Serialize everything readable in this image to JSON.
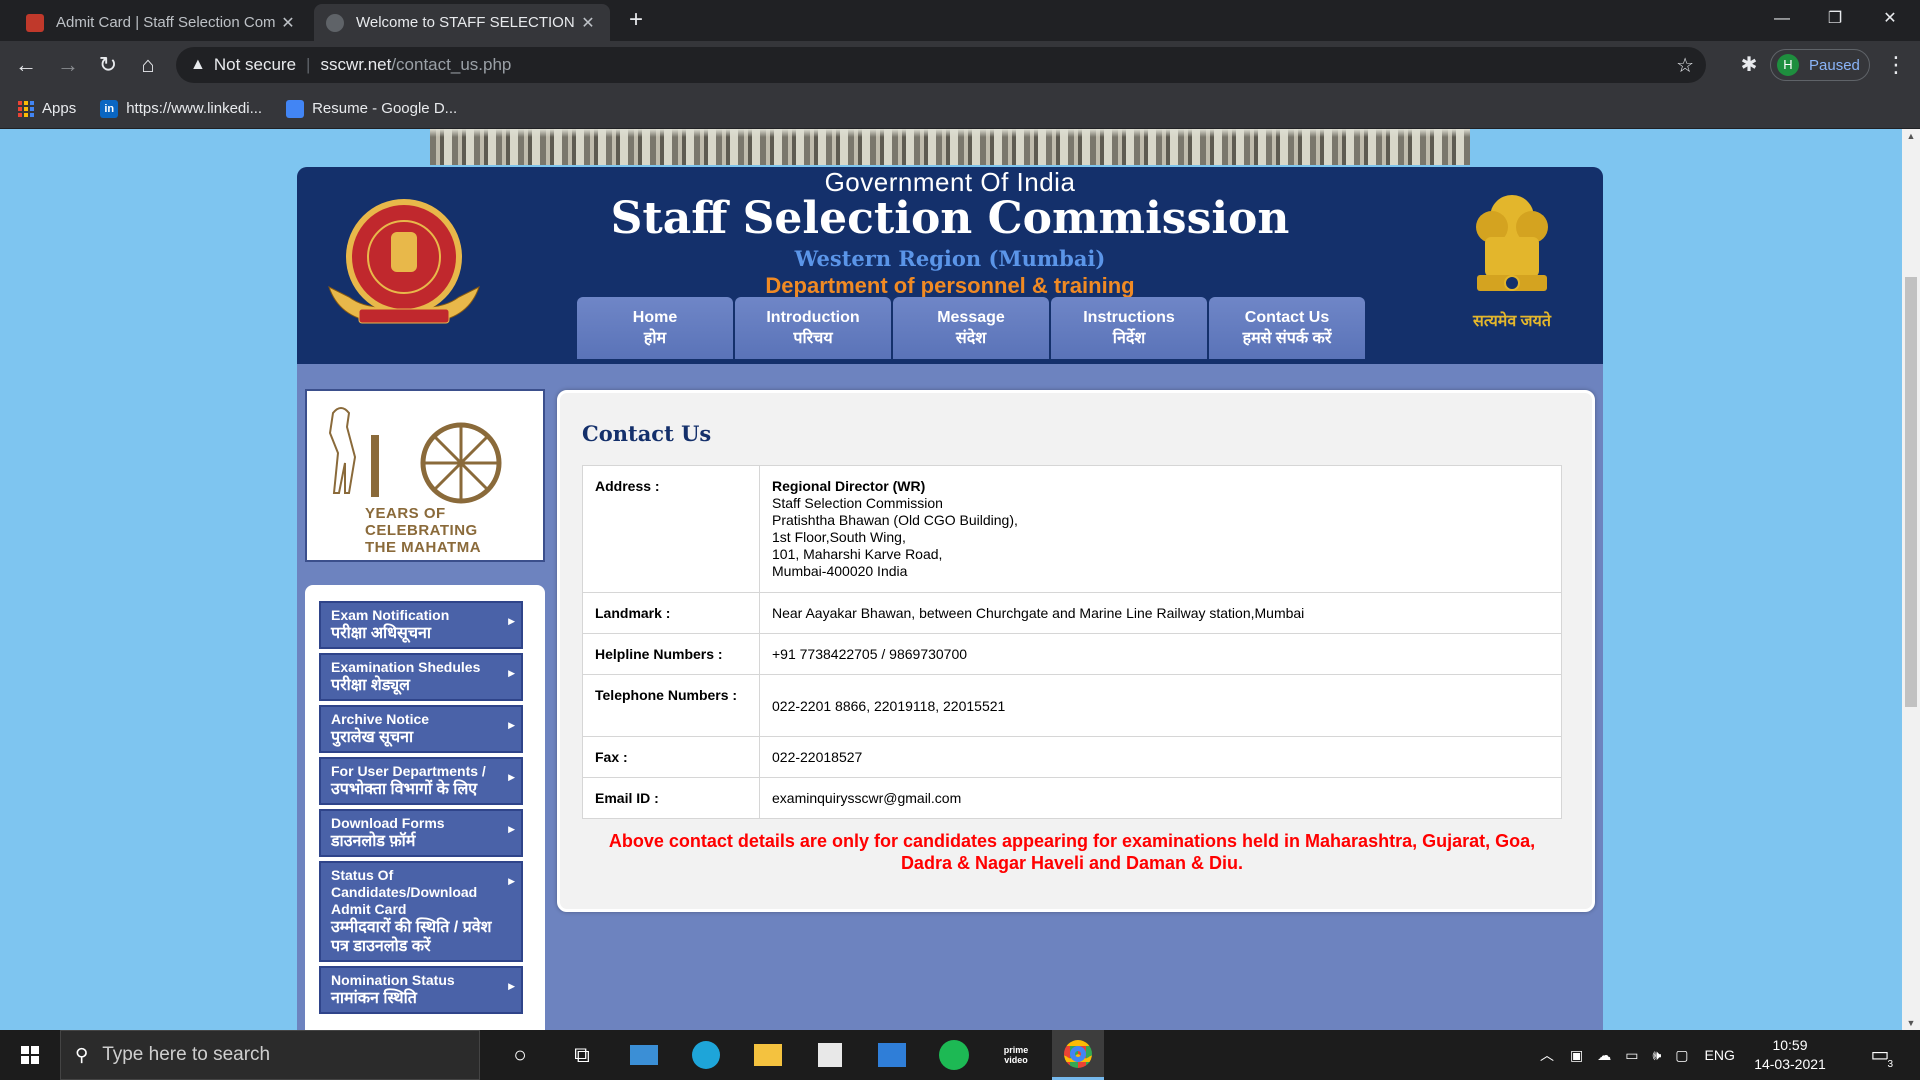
{
  "browser": {
    "tabs": [
      {
        "title": "Admit Card | Staff Selection Com",
        "active": false
      },
      {
        "title": "Welcome to STAFF SELECTION CO",
        "active": true
      }
    ],
    "security_label": "Not secure",
    "url_host": "sscwr.net",
    "url_path": "/contact_us.php",
    "profile_initial": "H",
    "profile_status": "Paused",
    "bookmarks": [
      "Apps",
      "https://www.linkedi...",
      "Resume - Google D..."
    ]
  },
  "header": {
    "gov": "Government Of India",
    "title": "Staff Selection Commission",
    "region": "Western Region (Mumbai)",
    "dept": "Department of personnel & training",
    "emblem_caption": "सत्यमेव जयते"
  },
  "topnav": [
    {
      "en": "Home",
      "hi": "होम"
    },
    {
      "en": "Introduction",
      "hi": "परिचय"
    },
    {
      "en": "Message",
      "hi": "संदेश"
    },
    {
      "en": "Instructions",
      "hi": "निर्देश"
    },
    {
      "en": "Contact Us",
      "hi": "हमसे संपर्क करें"
    }
  ],
  "gandhi": {
    "number": "150",
    "line1": "YEARS OF",
    "line2": "CELEBRATING",
    "line3": "THE MAHATMA"
  },
  "sidenav": [
    {
      "en": "Exam Notification",
      "hi": "परीक्षा अधिसूचना"
    },
    {
      "en": "Examination Shedules",
      "hi": "परीक्षा शेड्यूल"
    },
    {
      "en": "Archive Notice",
      "hi": "पुरालेख सूचना"
    },
    {
      "en": "For User Departments /",
      "hi": "उपभोक्ता विभागों के लिए"
    },
    {
      "en": "Download Forms",
      "hi": "डाउनलोड फ़ॉर्म"
    },
    {
      "en": "Status Of Candidates/Download Admit Card",
      "hi": "उम्मीदवारों की स्थिति / प्रवेश पत्र डाउनलोड करें"
    },
    {
      "en": "Nomination Status",
      "hi": "नामांकन स्थिति"
    }
  ],
  "contact": {
    "title": "Contact Us",
    "address_label": "Address :",
    "address_lines": [
      "Regional Director (WR)",
      "Staff Selection Commission",
      "Pratishtha Bhawan (Old CGO Building),",
      "1st Floor,South Wing,",
      "101, Maharshi Karve Road,",
      "Mumbai-400020 India"
    ],
    "landmark_label": "Landmark :",
    "landmark": "Near Aayakar Bhawan, between Churchgate and Marine Line Railway station,Mumbai",
    "helpline_label": "Helpline Numbers :",
    "helpline": "+91 7738422705 / 9869730700",
    "telephone_label": "Telephone Numbers :",
    "telephone": "022-2201 8866, 22019118, 22015521",
    "fax_label": "Fax :",
    "fax": "022-22018527",
    "email_label": "Email ID :",
    "email": "examinquirysscwr@gmail.com",
    "notice": "Above contact details are only for candidates appearing for examinations held in Maharashtra, Gujarat, Goa, Dadra & Nagar Haveli and Daman & Diu."
  },
  "taskbar": {
    "search_placeholder": "Type here to search",
    "language": "ENG",
    "time": "10:59",
    "date": "14-03-2021",
    "notification_count": "3"
  }
}
